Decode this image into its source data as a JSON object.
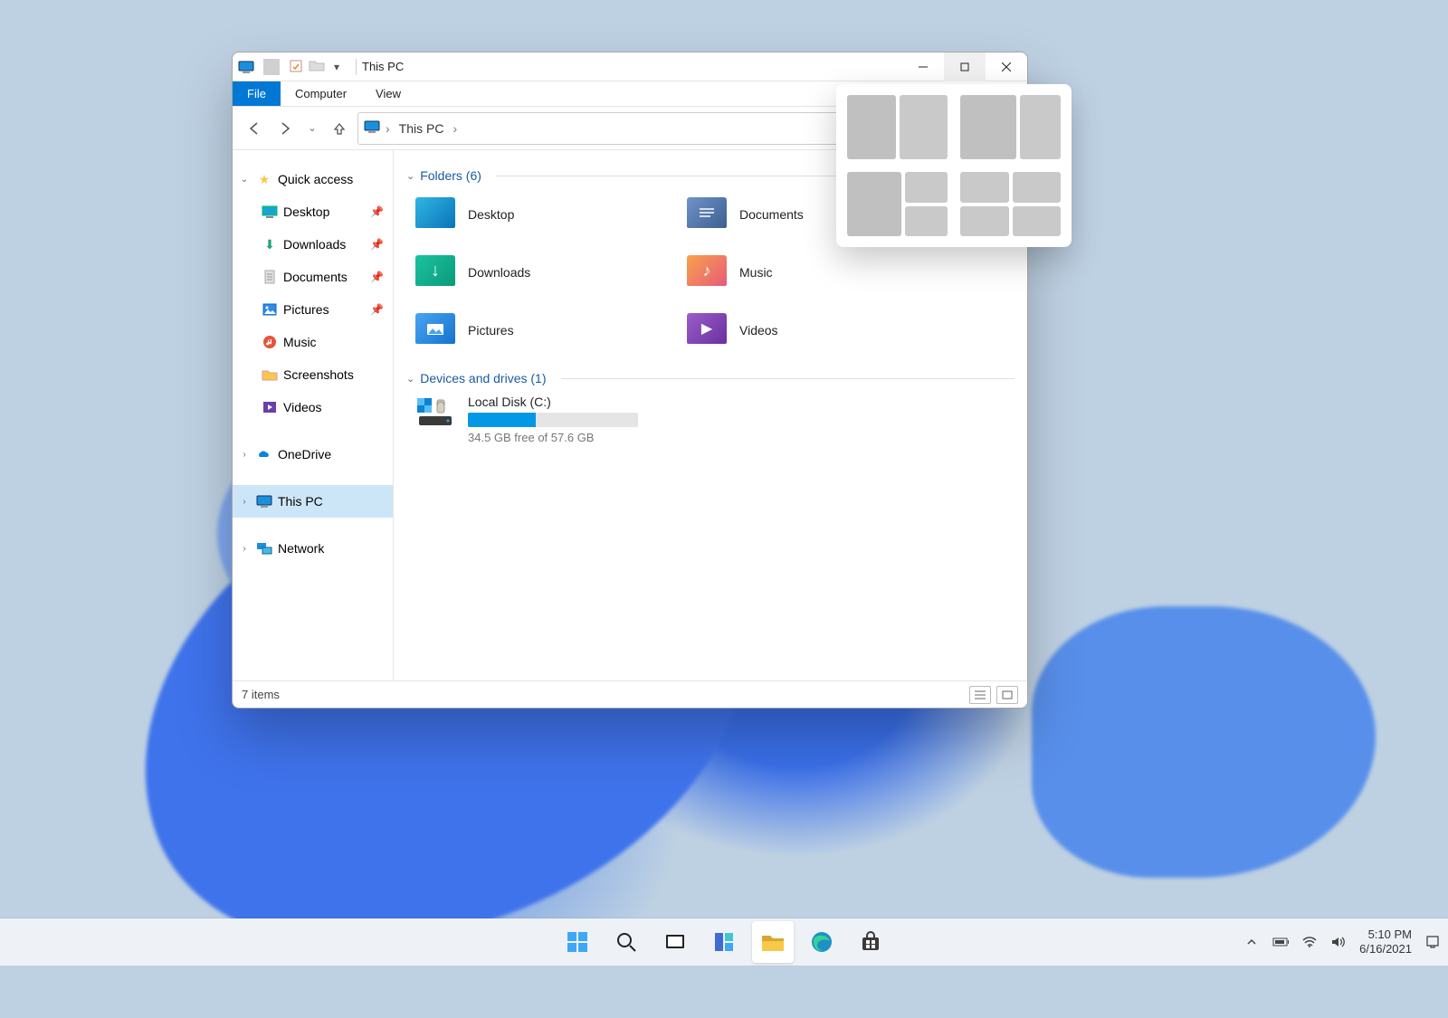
{
  "title": "This PC",
  "ribbon": {
    "file": "File",
    "computer": "Computer",
    "view": "View"
  },
  "address": {
    "crumb": "This PC"
  },
  "sidebar": {
    "quick_access": "Quick access",
    "items": [
      {
        "label": "Desktop"
      },
      {
        "label": "Downloads"
      },
      {
        "label": "Documents"
      },
      {
        "label": "Pictures"
      },
      {
        "label": "Music"
      },
      {
        "label": "Screenshots"
      },
      {
        "label": "Videos"
      }
    ],
    "onedrive": "OneDrive",
    "thispc": "This PC",
    "network": "Network"
  },
  "groups": {
    "folders": {
      "title": "Folders (6)"
    },
    "devices": {
      "title": "Devices and drives (1)"
    }
  },
  "folders": [
    {
      "label": "Desktop"
    },
    {
      "label": "Documents"
    },
    {
      "label": "Downloads"
    },
    {
      "label": "Music"
    },
    {
      "label": "Pictures"
    },
    {
      "label": "Videos"
    }
  ],
  "drive": {
    "name": "Local Disk (C:)",
    "free_text": "34.5 GB free of 57.6 GB",
    "fill_pct": 40
  },
  "status": {
    "items": "7 items"
  },
  "taskbar": {
    "time": "5:10 PM",
    "date": "6/16/2021"
  }
}
